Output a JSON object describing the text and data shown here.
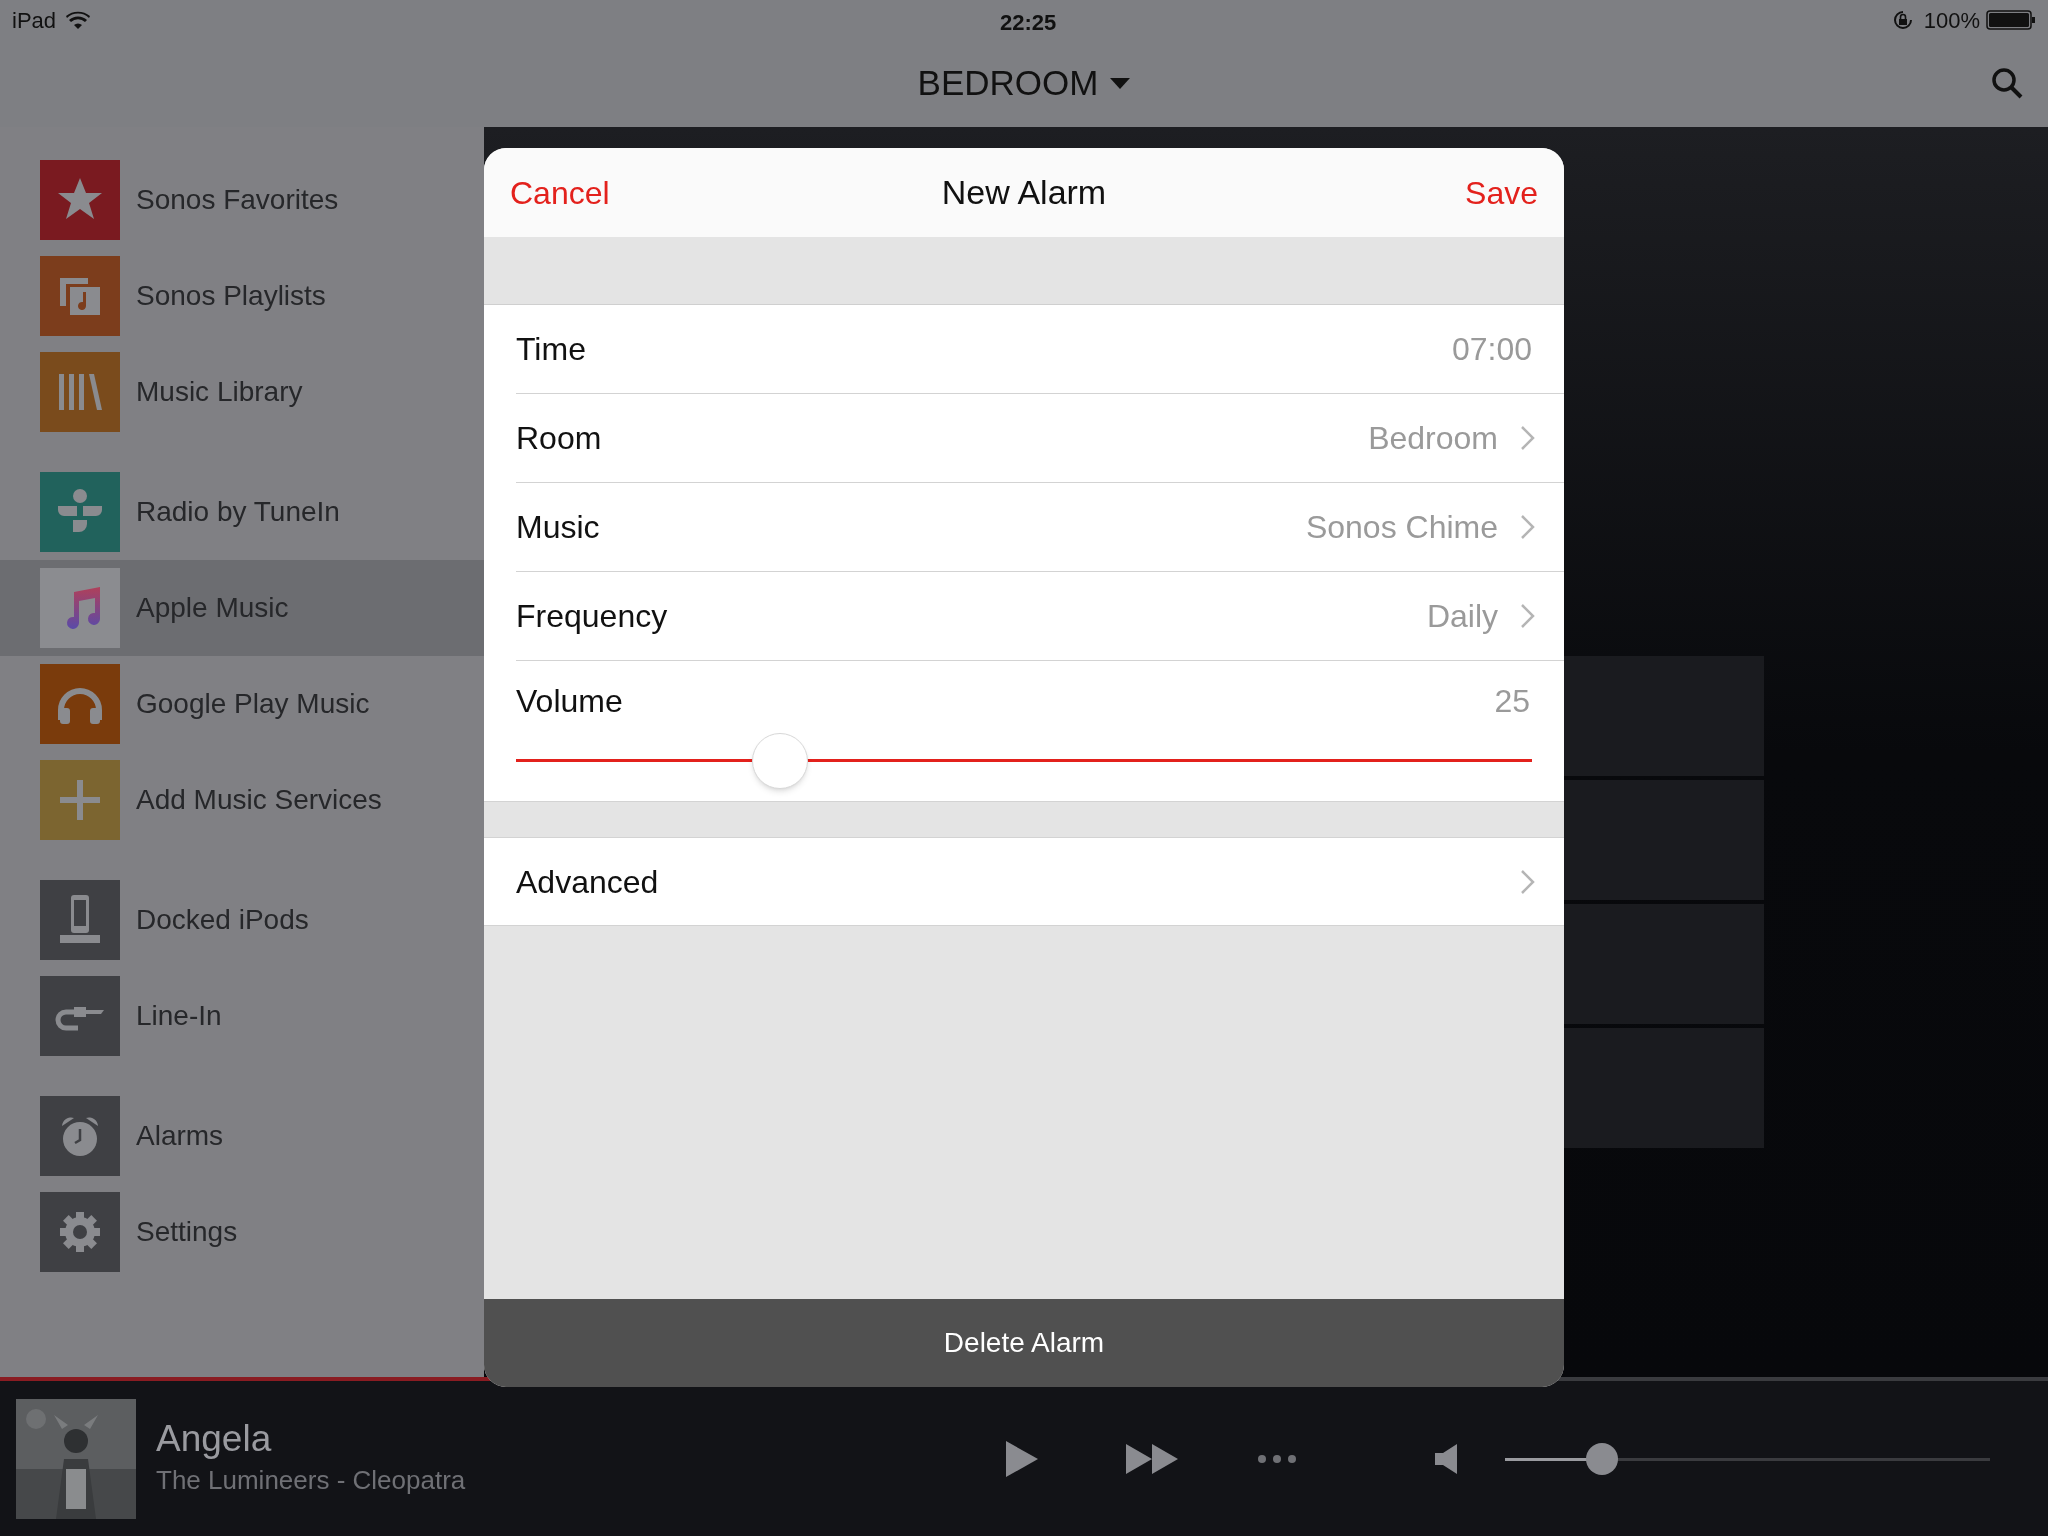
{
  "status_bar": {
    "device": "iPad",
    "time": "22:25",
    "battery": "100%"
  },
  "nav": {
    "room": "BEDROOM"
  },
  "sidebar": {
    "groups": [
      {
        "items": [
          {
            "label": "Sonos Favorites",
            "kind": "star",
            "color": "#7a1a20",
            "selected": false
          },
          {
            "label": "Sonos Playlists",
            "kind": "playlist",
            "color": "#7c3d1c",
            "selected": false
          },
          {
            "label": "Music Library",
            "kind": "library",
            "color": "#7a4b1c",
            "selected": false
          }
        ]
      },
      {
        "items": [
          {
            "label": "Radio by TuneIn",
            "kind": "tunein",
            "color": "#21625c",
            "selected": false
          },
          {
            "label": "Apple Music",
            "kind": "note",
            "color": "#8b8c90",
            "selected": true
          },
          {
            "label": "Google Play Music",
            "kind": "headphones",
            "color": "#7a3b0c",
            "selected": false
          },
          {
            "label": "Add Music Services",
            "kind": "plus",
            "color": "#7c6530",
            "selected": false
          }
        ]
      },
      {
        "items": [
          {
            "label": "Docked iPods",
            "kind": "dock",
            "color": "#3f4044",
            "selected": false
          },
          {
            "label": "Line-In",
            "kind": "cable",
            "color": "#3f4044",
            "selected": false
          }
        ]
      },
      {
        "items": [
          {
            "label": "Alarms",
            "kind": "alarm",
            "color": "#3f4044",
            "selected": false
          },
          {
            "label": "Settings",
            "kind": "gear",
            "color": "#3f4044",
            "selected": false
          }
        ]
      }
    ]
  },
  "dialog": {
    "cancel": "Cancel",
    "title": "New Alarm",
    "save": "Save",
    "rows": [
      {
        "kind": "value",
        "label": "Time",
        "value": "07:00"
      },
      {
        "kind": "link",
        "label": "Room",
        "value": "Bedroom"
      },
      {
        "kind": "link",
        "label": "Music",
        "value": "Sonos Chime"
      },
      {
        "kind": "link",
        "label": "Frequency",
        "value": "Daily"
      },
      {
        "kind": "slider",
        "label": "Volume",
        "value": "25",
        "level": 0.26
      }
    ],
    "advanced": {
      "label": "Advanced"
    },
    "delete": "Delete Alarm"
  },
  "now_playing": {
    "title": "Angela",
    "subtitle": "The Lumineers - Cleopatra",
    "progress": {
      "level": 0.24
    },
    "volume": {
      "level": 0.2
    }
  }
}
